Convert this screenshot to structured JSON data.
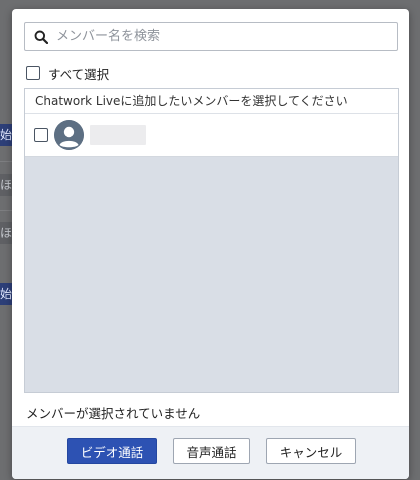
{
  "background": {
    "fragments": [
      "始",
      "ほし",
      "ほし",
      "始"
    ]
  },
  "dialog": {
    "search": {
      "placeholder": "メンバー名を検索",
      "value": ""
    },
    "select_all_label": "すべて選択",
    "list_header": "Chatwork Liveに追加したいメンバーを選択してください",
    "members": [
      {
        "name": "",
        "checked": false
      }
    ],
    "status": "メンバーが選択されていません",
    "buttons": {
      "video_call": "ビデオ通話",
      "voice_call": "音声通話",
      "cancel": "キャンセル"
    }
  },
  "colors": {
    "primary_button": "#2d52b3",
    "list_background": "#d9dee6",
    "footer_background": "#eef1f5",
    "overlay": "#6d6e70"
  },
  "icons": {
    "search": "search-icon",
    "avatar": "user-avatar-icon"
  }
}
